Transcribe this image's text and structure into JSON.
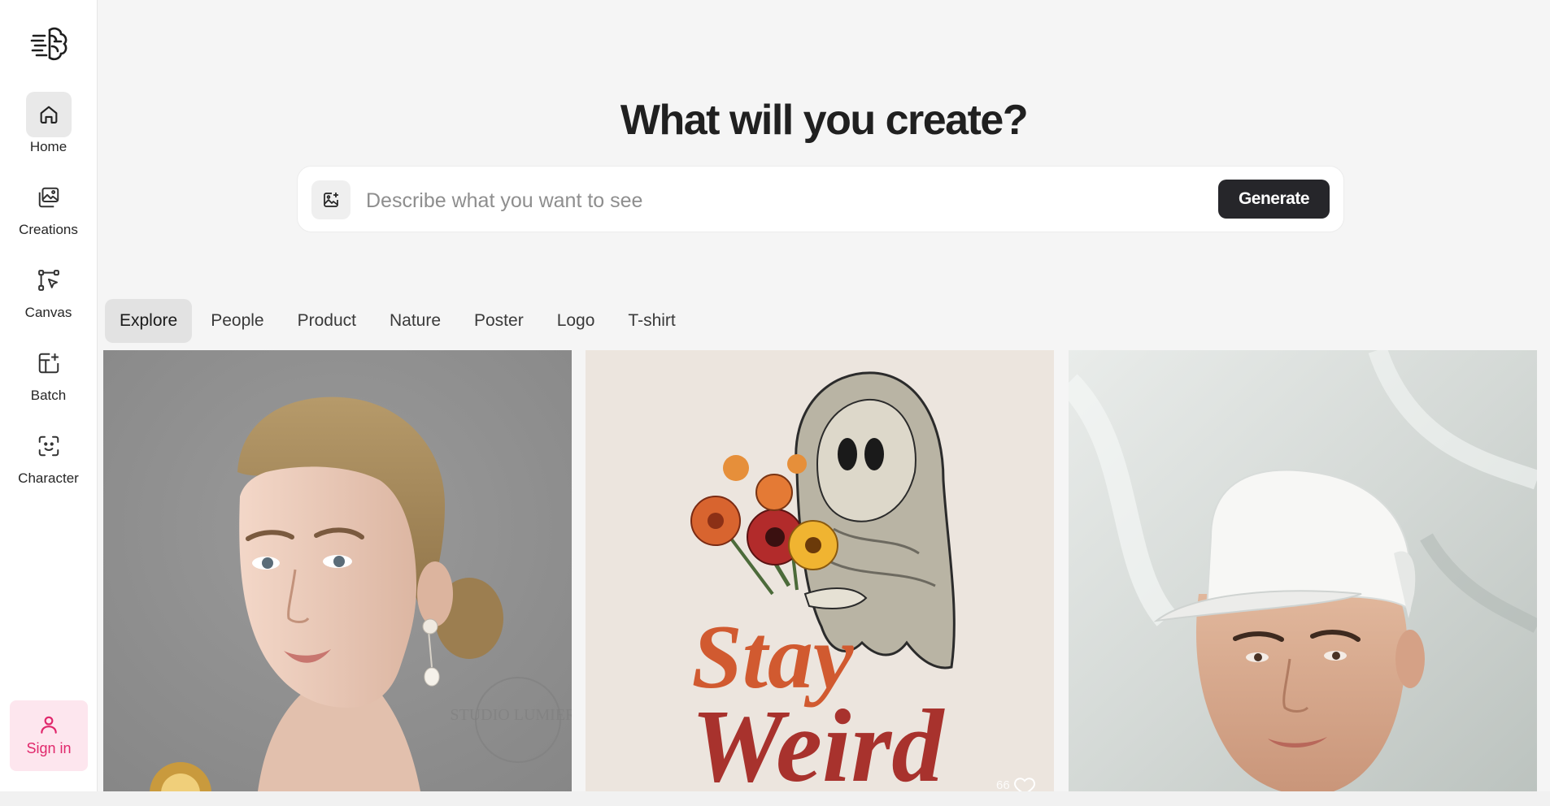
{
  "sidebar": {
    "logo_icon": "brain-icon",
    "items": [
      {
        "label": "Home",
        "icon": "home-icon",
        "active": true
      },
      {
        "label": "Creations",
        "icon": "gallery-icon",
        "active": false
      },
      {
        "label": "Canvas",
        "icon": "canvas-icon",
        "active": false
      },
      {
        "label": "Batch",
        "icon": "batch-icon",
        "active": false
      },
      {
        "label": "Character",
        "icon": "character-icon",
        "active": false
      }
    ],
    "signin_label": "Sign in",
    "signin_icon": "user-icon"
  },
  "hero": {
    "title": "What will you create?",
    "prompt_placeholder": "Describe what you want to see",
    "image_upload_icon": "image-add-icon",
    "generate_label": "Generate"
  },
  "tabs": [
    {
      "label": "Explore",
      "active": true
    },
    {
      "label": "People",
      "active": false
    },
    {
      "label": "Product",
      "active": false
    },
    {
      "label": "Nature",
      "active": false
    },
    {
      "label": "Poster",
      "active": false
    },
    {
      "label": "Logo",
      "active": false
    },
    {
      "label": "T-shirt",
      "active": false
    }
  ],
  "gallery": [
    {
      "subject": "portrait of woman with pearl earring",
      "watermark": "STUDIO LUMIERE"
    },
    {
      "subject": "ghost holding flowers t-shirt design",
      "text_line1": "Stay",
      "text_line2": "Weird",
      "likes": "66"
    },
    {
      "subject": "man wearing white cap"
    }
  ],
  "colors": {
    "accent_pink": "#e0276b",
    "signin_bg": "#fde6ee",
    "generate_bg": "#26262a",
    "page_bg": "#f5f5f5"
  }
}
